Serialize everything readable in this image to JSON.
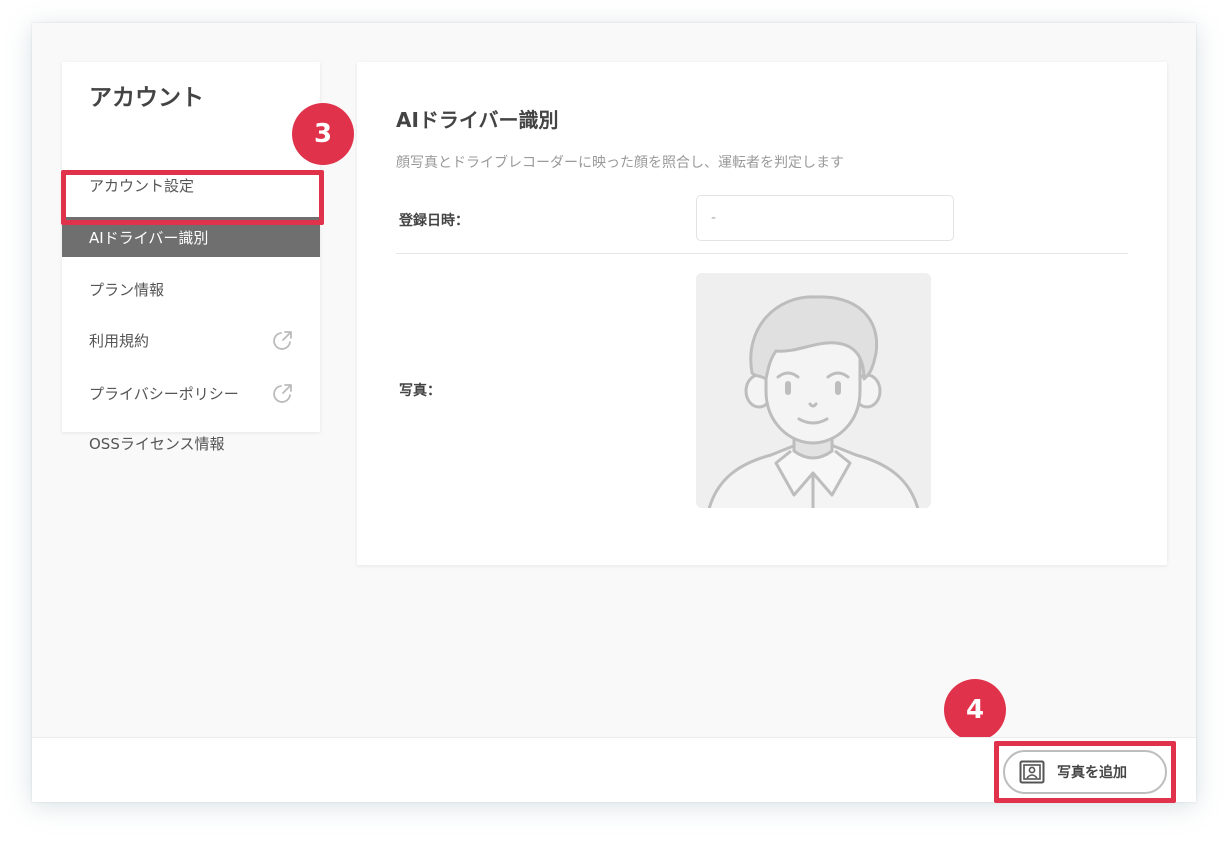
{
  "sidebar": {
    "title": "アカウント",
    "items": [
      {
        "label": "アカウント設定",
        "external": false
      },
      {
        "label": "AIドライバー識別",
        "external": false,
        "active": true
      },
      {
        "label": "プラン情報",
        "external": false
      },
      {
        "label": "利用規約",
        "external": true
      },
      {
        "label": "プライバシーポリシー",
        "external": true
      },
      {
        "label": "OSSライセンス情報",
        "external": false
      }
    ]
  },
  "main": {
    "title": "AIドライバー識別",
    "description": "顔写真とドライブレコーダーに映った顔を照合し、運転者を判定します",
    "registered_label": "登録日時：",
    "registered_value": "-",
    "photo_label": "写真：",
    "photo_icon": "avatar-placeholder-icon"
  },
  "footer": {
    "add_photo_label": "写真を追加",
    "add_photo_icon": "portrait-icon"
  },
  "badges": {
    "step3": "3",
    "step4": "4"
  },
  "colors": {
    "accent": "#e0334b",
    "active_item": "#6f6f6f"
  }
}
